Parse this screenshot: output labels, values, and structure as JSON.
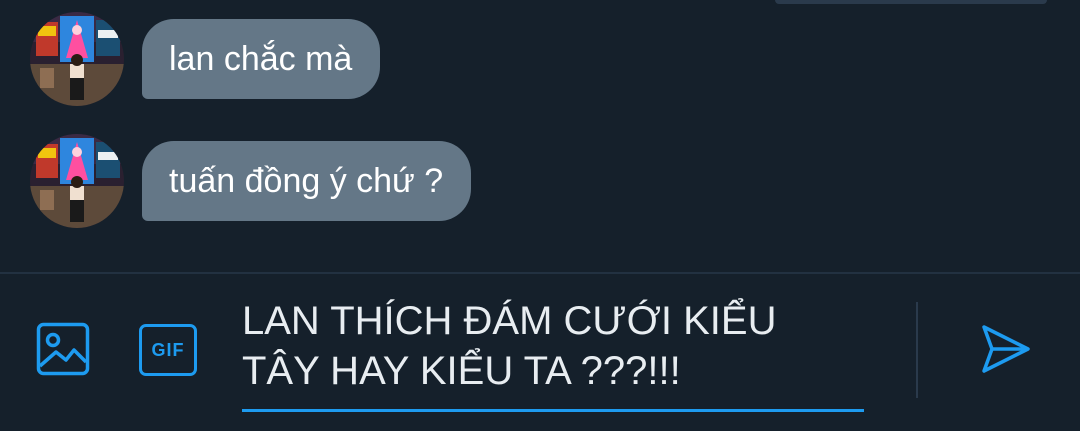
{
  "conversation": {
    "messages": [
      {
        "text": "lan chắc mà"
      },
      {
        "text": "tuấn đồng ý chứ ?"
      }
    ]
  },
  "composer": {
    "gif_label": "GIF",
    "input_value": "LAN THÍCH ĐÁM CƯỚI KIỂU\nTÂY HAY KIỂU TA ???!!!",
    "accent_color": "#1d9bf0"
  },
  "icons": {
    "image": "image-icon",
    "gif": "gif-icon",
    "send": "send-icon"
  },
  "colors": {
    "background": "#15202b",
    "bubble": "#647787",
    "accent": "#1d9bf0"
  }
}
